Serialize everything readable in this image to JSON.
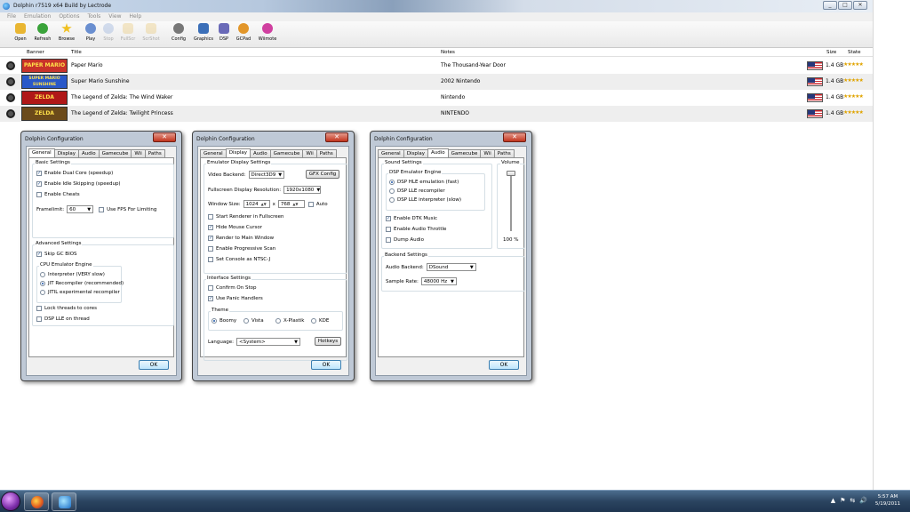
{
  "window": {
    "title": "Dolphin r7519 x64 Build by Lectrode",
    "controls": [
      "_",
      "□",
      "✕"
    ]
  },
  "menu": [
    "File",
    "Emulation",
    "Options",
    "Tools",
    "View",
    "Help"
  ],
  "toolbar": [
    {
      "label": "Open",
      "icon": "open-folder-icon",
      "color": "#e9b632",
      "enabled": true
    },
    {
      "label": "Refresh",
      "icon": "refresh-icon",
      "color": "#3aa33a",
      "enabled": true
    },
    {
      "label": "Browse",
      "icon": "browse-star-icon",
      "color": "#f0c020",
      "enabled": true
    },
    {
      "label": "Play",
      "icon": "play-icon",
      "color": "#6a8fd0",
      "enabled": true
    },
    {
      "label": "Stop",
      "icon": "stop-icon",
      "color": "#8aa6d6",
      "enabled": false
    },
    {
      "label": "FullScr",
      "icon": "fullscreen-icon",
      "color": "#e8c26a",
      "enabled": false
    },
    {
      "label": "ScrShot",
      "icon": "screenshot-icon",
      "color": "#e8c26a",
      "enabled": false
    },
    {
      "label": "Config",
      "icon": "config-icon",
      "color": "#777777",
      "enabled": true
    },
    {
      "label": "Graphics",
      "icon": "graphics-icon",
      "color": "#3b6fb8",
      "enabled": true
    },
    {
      "label": "DSP",
      "icon": "dsp-icon",
      "color": "#6a6ab8",
      "enabled": true
    },
    {
      "label": "GCPad",
      "icon": "gcpad-icon",
      "color": "#e2962a",
      "enabled": true
    },
    {
      "label": "Wiimote",
      "icon": "wiimote-icon",
      "color": "#d040a0",
      "enabled": true
    }
  ],
  "list": {
    "headers": {
      "banner": "Banner",
      "title": "Title",
      "notes": "Notes",
      "size": "Size",
      "state": "State"
    },
    "games": [
      {
        "banner": "PAPER MARIO",
        "banner_color": "#c8322a",
        "title": "Paper Mario",
        "notes": "The Thousand-Year Door",
        "size": "1.4 GB",
        "stars": "★★★★★"
      },
      {
        "banner": "SUPER MARIO SUNSHINE",
        "banner_color": "#2a58c8",
        "title": "Super Mario Sunshine",
        "notes": "2002  Nintendo",
        "size": "1.4 GB",
        "stars": "★★★★★"
      },
      {
        "banner": "ZELDA",
        "banner_color": "#b01818",
        "title": "The Legend of Zelda: The Wind Waker",
        "notes": "Nintendo",
        "size": "1.4 GB",
        "stars": "★★★★★"
      },
      {
        "banner": "ZELDA",
        "banner_color": "#6b4a1a",
        "title": "The Legend of Zelda: Twilight Princess",
        "notes": "NINTENDO",
        "size": "1.4 GB",
        "stars": "★★★★★"
      }
    ]
  },
  "dialogs": {
    "title": "Dolphin Configuration",
    "close": "✕",
    "ok": "OK",
    "tabs": [
      "General",
      "Display",
      "Audio",
      "Gamecube",
      "Wii",
      "Paths"
    ],
    "general": {
      "basic_settings": "Basic Settings",
      "dual_core": "Enable Dual Core (speedup)",
      "idle_skip": "Enable Idle Skipping (speedup)",
      "cheats": "Enable Cheats",
      "framelimit_label": "Framelimit:",
      "framelimit_value": "60",
      "fps_limit": "Use FPS For Limiting",
      "advanced_settings": "Advanced Settings",
      "skip_bios": "Skip GC BIOS",
      "cpu_engine": "CPU Emulator Engine",
      "interpreter": "Interpreter (VERY slow)",
      "jit": "JIT Recompiler (recommended)",
      "jitil": "JITIL experimental recompiler",
      "lock_threads": "Lock threads to cores",
      "dsp_thread": "DSP LLE on thread"
    },
    "display": {
      "emu_display": "Emulator Display Settings",
      "video_backend_label": "Video Backend:",
      "video_backend": "Direct3D9",
      "gfx_config": "GFX Config",
      "fullscreen_res_label": "Fullscreen Display Resolution:",
      "fullscreen_res": "1920x1080",
      "window_size_label": "Window Size:",
      "width": "1024",
      "x": "x",
      "height": "768",
      "auto": "Auto",
      "start_fullscreen": "Start Renderer in Fullscreen",
      "hide_cursor": "Hide Mouse Cursor",
      "render_main": "Render to Main Window",
      "progressive": "Enable Progressive Scan",
      "ntsc": "Set Console as NTSC-J",
      "interface": "Interface Settings",
      "confirm_stop": "Confirm On Stop",
      "panic": "Use Panic Handlers",
      "theme": "Theme",
      "themes": [
        "Boomy",
        "Vista",
        "X-Plastik",
        "KDE"
      ],
      "language_label": "Language:",
      "language": "<System>",
      "hotkeys": "Hotkeys"
    },
    "audio": {
      "sound_settings": "Sound Settings",
      "dsp_engine": "DSP Emulator Engine",
      "hle": "DSP HLE emulation (fast)",
      "lle_rec": "DSP LLE recompiler",
      "lle_int": "DSP LLE interpreter (slow)",
      "dtk": "Enable DTK Music",
      "throttle": "Enable Audio Throttle",
      "dump": "Dump Audio",
      "volume_label": "Volume",
      "volume_value": "100 %",
      "volume_level": 1.0,
      "backend_settings": "Backend Settings",
      "backend_label": "Audio Backend:",
      "backend": "DSound",
      "rate_label": "Sample Rate:",
      "rate": "48000 Hz"
    }
  },
  "taskbar": {
    "tray_icons": [
      "▲",
      "⚑",
      "⇆",
      "🔊"
    ],
    "time": "5:57 AM",
    "date": "5/19/2011"
  }
}
